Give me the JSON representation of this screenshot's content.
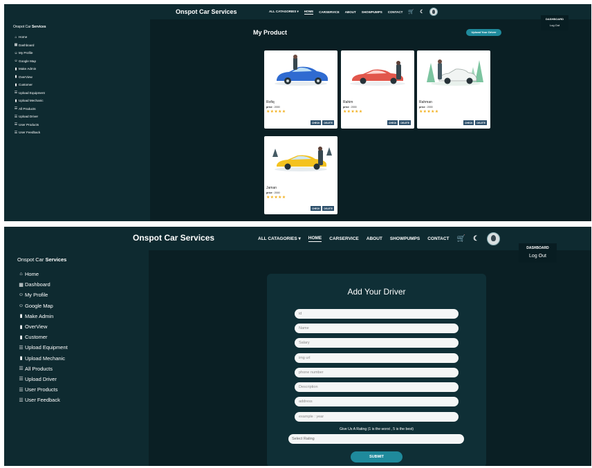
{
  "brand": "Onspot Car Services",
  "nav": {
    "categories": "ALL CATAGORIES ▾",
    "home": "HOME",
    "carservice": "CARSERVICE",
    "about": "ABOUT",
    "showpumps": "SHOWPUMPS",
    "contact": "CONTACT"
  },
  "dropdown": {
    "dashboard": "DASHBOARD",
    "logout": "Log Out"
  },
  "sidebar": {
    "title_prefix": "Onspot Car ",
    "title_bold": "Services",
    "items": [
      {
        "label": "Home",
        "icon": "home-icon",
        "glyph": "⌂"
      },
      {
        "label": "Dashboard",
        "icon": "grid-icon",
        "glyph": "▦"
      },
      {
        "label": "My Profile",
        "icon": "user-icon",
        "glyph": "☺"
      },
      {
        "label": "Google Map",
        "icon": "user-icon",
        "glyph": "☺"
      },
      {
        "label": "Make Admin",
        "icon": "bookmark-icon",
        "glyph": "▮"
      },
      {
        "label": "OverView",
        "icon": "bookmark-icon",
        "glyph": "▮"
      },
      {
        "label": "Customer",
        "icon": "bookmark-icon",
        "glyph": "▮"
      },
      {
        "label": "Upload Equipment",
        "icon": "list-icon",
        "glyph": "☰"
      },
      {
        "label": "Upload Mechanic",
        "icon": "bookmark-icon",
        "glyph": "▮"
      },
      {
        "label": "All Products",
        "icon": "list-icon",
        "glyph": "☰"
      },
      {
        "label": "Upload Driver",
        "icon": "list-icon",
        "glyph": "☰"
      },
      {
        "label": "User Products",
        "icon": "list-icon",
        "glyph": "☰"
      },
      {
        "label": "User Feedback",
        "icon": "list-icon",
        "glyph": "☰"
      }
    ]
  },
  "products_page": {
    "title": "My Product",
    "upload_button": "Upload Your Driver",
    "price_label": "price",
    "check_label": "CHECK",
    "delete_label": "DELETE",
    "stars": "★★★★★",
    "cards": [
      {
        "name": "Rofiq",
        "price": ": 2000",
        "car_color": "#2f6bd1"
      },
      {
        "name": "Rahim",
        "price": ": 2000",
        "car_color": "#e2574c"
      },
      {
        "name": "Rahman",
        "price": ": 2000",
        "car_color": "#f1f4f3"
      },
      {
        "name": "Jaman",
        "price": ": 2000",
        "car_color": "#f4c21f"
      }
    ]
  },
  "driver_form": {
    "title": "Add Your Driver",
    "fields": [
      "id",
      "Name",
      "Salary",
      "img url",
      "phone number",
      "Description",
      "address",
      "example : year"
    ],
    "rating_label": "Give Us A Rating (1 is the worst , 5 is the best)",
    "rating_select": "Select Rating",
    "submit": "SUBMIT"
  },
  "colors": {
    "background": "#0a1f24",
    "panel": "#0e2a30",
    "accent": "#1f8a9c",
    "star": "#f2b01e"
  }
}
